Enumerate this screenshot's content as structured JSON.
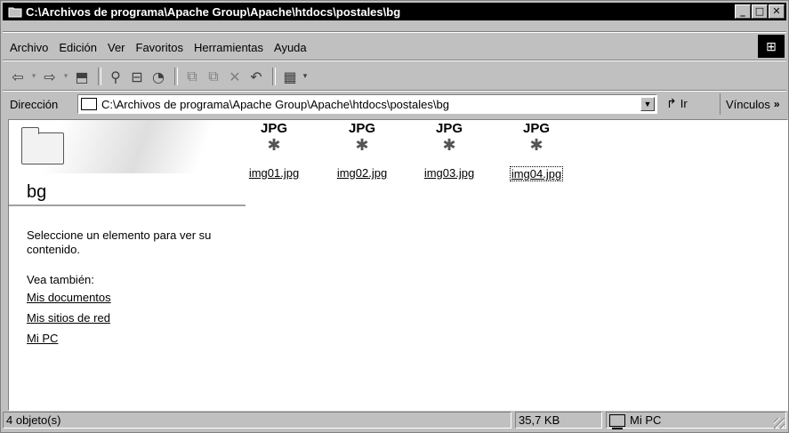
{
  "window": {
    "title": "C:\\Archivos de programa\\Apache Group\\Apache\\htdocs\\postales\\bg",
    "buttons": [
      "_",
      "□",
      "✕"
    ]
  },
  "menu": {
    "items": [
      {
        "label": "Archivo"
      },
      {
        "label": "Edición"
      },
      {
        "label": "Ver"
      },
      {
        "label": "Favoritos"
      },
      {
        "label": "Herramientas"
      },
      {
        "label": "Ayuda"
      }
    ]
  },
  "toolbar": {
    "icons": [
      "back-icon",
      "forward-icon",
      "up-folder-icon",
      "search-icon",
      "folders-icon",
      "history-icon",
      "move-to-icon",
      "copy-to-icon",
      "delete-icon",
      "undo-icon",
      "views-icon"
    ]
  },
  "address": {
    "label": "Dirección",
    "value": "C:\\Archivos de programa\\Apache Group\\Apache\\htdocs\\postales\\bg",
    "go_label": "Ir",
    "links_label": "Vínculos"
  },
  "panel": {
    "folder_name": "bg",
    "prompt": "Seleccione un elemento para ver su contenido.",
    "see_also": "Vea también:",
    "links": [
      "Mis documentos",
      "Mis sitios de red",
      "Mi PC"
    ]
  },
  "files": [
    {
      "type_label": "JPG",
      "name": "img01.jpg",
      "selected": false
    },
    {
      "type_label": "JPG",
      "name": "img02.jpg",
      "selected": false
    },
    {
      "type_label": "JPG",
      "name": "img03.jpg",
      "selected": false
    },
    {
      "type_label": "JPG",
      "name": "img04.jpg",
      "selected": true
    }
  ],
  "status": {
    "count": "4 objeto(s)",
    "size": "35,7 KB",
    "location": "Mi PC"
  }
}
